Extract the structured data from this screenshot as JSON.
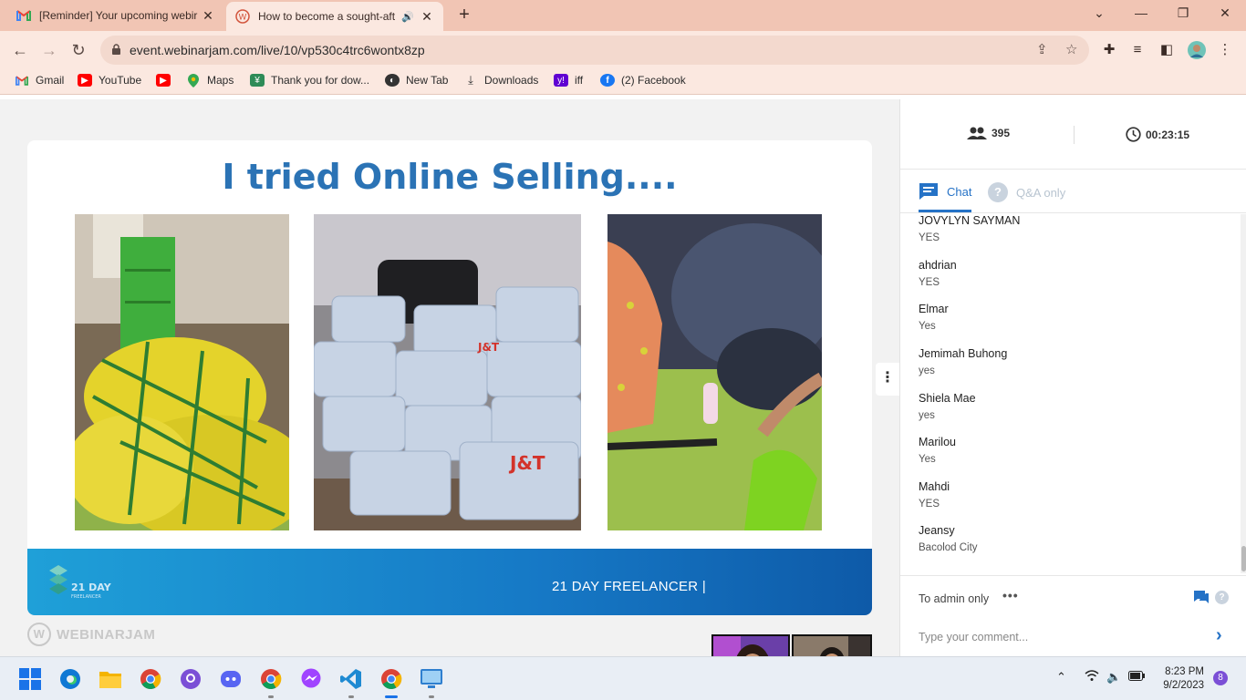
{
  "browser": {
    "tabs": [
      {
        "title": "[Reminder] Your upcoming webir",
        "icon": "gmail-icon"
      },
      {
        "title": "How to become a sought-aft",
        "icon": "webinarjam-icon",
        "audio": true
      }
    ],
    "url": "event.webinarjam.com/live/10/vp530c4trc6wontx8zp",
    "bookmarks": [
      {
        "label": "Gmail",
        "icon": "gmail-icon",
        "color": "#ea4335"
      },
      {
        "label": "YouTube",
        "icon": "youtube-icon",
        "color": "#ff0000"
      },
      {
        "label": "",
        "icon": "youtube-icon",
        "color": "#ff0000"
      },
      {
        "label": "Maps",
        "icon": "maps-icon",
        "color": "#34a853"
      },
      {
        "label": "Thank you for dow...",
        "icon": "download-site-icon",
        "color": "#2e8b57"
      },
      {
        "label": "New Tab",
        "icon": "globe-icon",
        "color": "#333333"
      },
      {
        "label": "Downloads",
        "icon": "download-icon",
        "color": "#333333"
      },
      {
        "label": "iff",
        "icon": "yahoo-icon",
        "color": "#6001d2"
      },
      {
        "label": "(2) Facebook",
        "icon": "facebook-icon",
        "color": "#1877f2"
      }
    ]
  },
  "slide": {
    "title": "I tried Online Selling....",
    "banner_text": "21 DAY FREELANCER |",
    "logo_text": "21 DAY",
    "logo_sub": "FREELANCER"
  },
  "branding": {
    "webinarjam": "WEBINARJAM"
  },
  "panel": {
    "attendees": "395",
    "timer": "00:23:15",
    "tabs": {
      "chat": "Chat",
      "qa": "Q&A only"
    },
    "messages": [
      {
        "name": "JOVYLYN SAYMAN",
        "text": "YES"
      },
      {
        "name": "ahdrian",
        "text": "YES"
      },
      {
        "name": "Elmar",
        "text": "Yes"
      },
      {
        "name": "Jemimah Buhong",
        "text": "yes"
      },
      {
        "name": "Shiela Mae",
        "text": "yes"
      },
      {
        "name": "Marilou",
        "text": "Yes"
      },
      {
        "name": "Mahdi",
        "text": "YES"
      },
      {
        "name": "Jeansy",
        "text": "Bacolod City"
      }
    ],
    "audience_label": "To admin only",
    "comment_placeholder": "Type your comment..."
  },
  "taskbar": {
    "apps": [
      "windows-start-icon",
      "edge-icon",
      "file-explorer-icon",
      "chrome-icon",
      "github-desktop-icon",
      "discord-icon",
      "chrome-profile-icon",
      "messenger-icon",
      "vscode-icon",
      "chrome-active-icon",
      "remote-desktop-icon"
    ],
    "time": "8:23 PM",
    "date": "9/2/2023",
    "notifications": "8"
  },
  "colors": {
    "accent": "#2572c6",
    "slide_title": "#2b73b5",
    "chrome_frame": "#f1c5b4"
  }
}
